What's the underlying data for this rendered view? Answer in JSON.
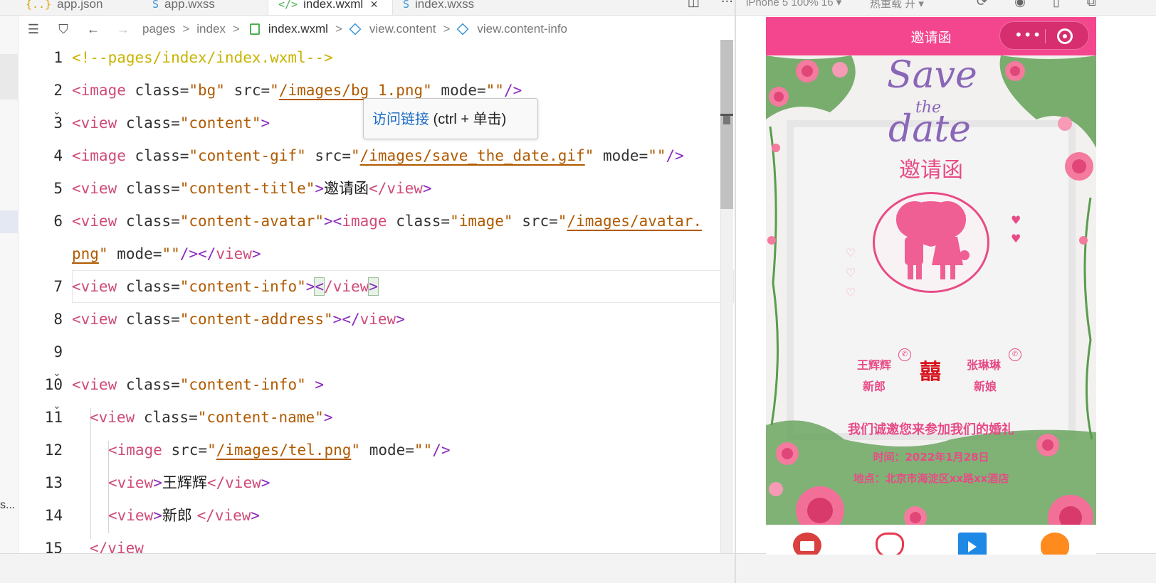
{
  "tabs": [
    {
      "label": "app.json",
      "icon": "{..}"
    },
    {
      "label": "app.wxss",
      "icon": "S"
    },
    {
      "label": "index.wxml",
      "icon": "</>",
      "active": true,
      "close": "×"
    },
    {
      "label": "index.wxss",
      "icon": "S"
    }
  ],
  "tab_tools": {
    "split": "◫",
    "more": "···"
  },
  "left_strip": {
    "truncated": "s..."
  },
  "breadcrumb": {
    "segments": [
      "pages",
      "index",
      "index.wxml",
      "view.content",
      "view.content-info"
    ],
    "sep": ">"
  },
  "editor": {
    "lines": [
      {
        "n": "1",
        "fold": false
      },
      {
        "n": "2",
        "fold": false
      },
      {
        "n": "3",
        "fold": true
      },
      {
        "n": "4",
        "fold": false
      },
      {
        "n": "5",
        "fold": false
      },
      {
        "n": "6",
        "fold": false
      },
      {
        "n": "",
        "fold": false
      },
      {
        "n": "7",
        "fold": false
      },
      {
        "n": "8",
        "fold": false
      },
      {
        "n": "9",
        "fold": false
      },
      {
        "n": "10",
        "fold": true
      },
      {
        "n": "11",
        "fold": true
      },
      {
        "n": "12",
        "fold": false
      },
      {
        "n": "13",
        "fold": false
      },
      {
        "n": "14",
        "fold": false
      },
      {
        "n": "15",
        "fold": false
      }
    ],
    "code": {
      "l1": "<!--pages/index/index.wxml-->",
      "l2a": "<image",
      "l2b": " class=",
      "l2c": "\"bg\"",
      "l2d": " src=",
      "l2e": "\"",
      "l2f": "/images/bg_1.png",
      "l2g": "\"",
      "l2h": " mode=",
      "l2i": "\"\"",
      "l2j": "/>",
      "l3a": "<view",
      "l3b": " class=",
      "l3c": "\"content\"",
      "l3d": ">",
      "l4a": "<image",
      "l4b": " class=",
      "l4c": "\"content-gif\"",
      "l4d": " src=",
      "l4e": "\"",
      "l4f": "/images/save_the_date.gif",
      "l4g": "\"",
      "l4h": " mode=",
      "l4i": "\"\"",
      "l4j": "/>",
      "l5a": "<view",
      "l5b": " class=",
      "l5c": "\"content-title\"",
      "l5d": ">",
      "l5e": "邀请函",
      "l5f": "</view",
      "l5g": ">",
      "l6a": "<view",
      "l6b": " class=",
      "l6c": "\"content-avatar\"",
      "l6d": "><",
      "l6e": "image",
      "l6f": " class=",
      "l6g": "\"image\"",
      "l6h": " src=",
      "l6i": "\"",
      "l6j": "/images/avatar.",
      "l6k": "png",
      "l6l": "\"",
      "l6m": " mode=",
      "l6n": "\"\"",
      "l6o": "/></",
      "l6p": "view",
      "l6q": ">",
      "l7a": "<view",
      "l7b": " class=",
      "l7c": "\"content-info\"",
      "l7d": ">",
      "l7e": "<",
      "l7f": "/view",
      "l7g": ">",
      "l8a": "<view",
      "l8b": " class=",
      "l8c": "\"content-address\"",
      "l8d": "></",
      "l8e": "view",
      "l8f": ">",
      "l10a": "<view",
      "l10b": " class=",
      "l10c": "\"content-info\"",
      "l10d": " >",
      "l11a": "<view",
      "l11b": " class=",
      "l11c": "\"content-name\"",
      "l11d": ">",
      "l12a": "<image",
      "l12b": " src=",
      "l12c": "\"",
      "l12d": "/images/tel.png",
      "l12e": "\"",
      "l12f": " mode=",
      "l12g": "\"\"",
      "l12h": "/>",
      "l13a": "<view",
      "l13b": ">",
      "l13c": "王辉辉",
      "l13d": "</view",
      "l13e": ">",
      "l14a": "<view",
      "l14b": ">",
      "l14c": "新郎 ",
      "l14d": "</view",
      "l14e": ">",
      "l15a": "</view"
    }
  },
  "tooltip": {
    "link": "访问链接",
    "hint": " (ctrl + 单击)"
  },
  "simulator": {
    "device": "iPhone 5 100% 16 ▾",
    "hot_reload": "热重载 开 ▾",
    "tools": [
      "⟳",
      "◉",
      "▯",
      "⧉"
    ]
  },
  "phone": {
    "nav_title": "邀请函",
    "capsule_dots": "•••",
    "save_word": "Save",
    "the_word": "the",
    "date_word": "date",
    "title": "邀请函",
    "groom_name": "王辉辉",
    "groom_role": "新郎",
    "bride_name": "张琳琳",
    "bride_role": "新娘",
    "double_happiness": "囍",
    "invite_line": "我们诚邀您来参加我们的婚礼",
    "time_line": "时间：2022年1月28日",
    "address_line": "地点：北京市海淀区xx路xx酒店",
    "heart": "♥",
    "heart_outline": "♡",
    "tel_glyph": "✆"
  },
  "colors": {
    "accent_pink": "#f4468e",
    "text_pink": "#e84b86",
    "purple": "#8a66b8",
    "red_xi": "#d8141e"
  }
}
